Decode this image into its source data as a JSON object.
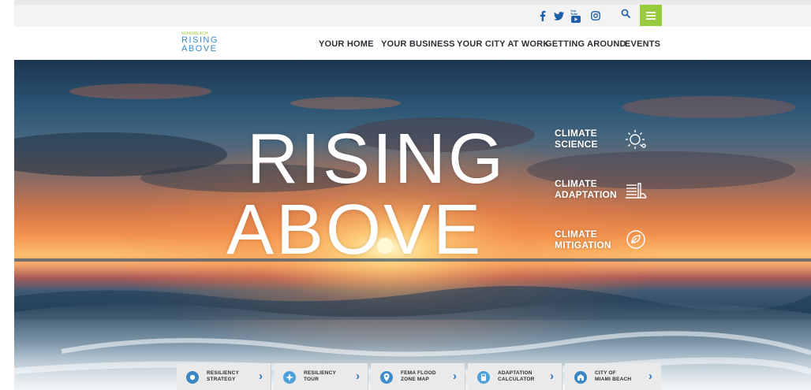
{
  "social": {
    "icons": [
      "facebook-icon",
      "twitter-icon",
      "youtube-icon",
      "instagram-icon"
    ],
    "youtube_text": "You Tube"
  },
  "utility": {
    "search_icon": "search-icon",
    "menu_icon": "hamburger-menu-icon"
  },
  "logo": {
    "small": "MIAMIBEACH",
    "line1": "RISING",
    "line2": "ABOVE"
  },
  "nav": {
    "items": [
      "YOUR HOME",
      "YOUR BUSINESS",
      "YOUR CITY AT WORK",
      "GETTING AROUND",
      "EVENTS"
    ]
  },
  "hero": {
    "title_line1": "RISING",
    "title_line2": "ABOVE"
  },
  "side_links": [
    {
      "line1": "CLIMATE",
      "line2": "SCIENCE",
      "icon": "sun-science-icon"
    },
    {
      "line1": "CLIMATE",
      "line2": "ADAPTATION",
      "icon": "seawall-adaptation-icon"
    },
    {
      "line1": "CLIMATE",
      "line2": "MITIGATION",
      "icon": "leaf-cycle-icon"
    }
  ],
  "cards": [
    {
      "line1": "RESILIENCY",
      "line2": "STRATEGY",
      "icon": "strategy-icon"
    },
    {
      "line1": "RESILIENCY",
      "line2": "TOUR",
      "icon": "tour-icon"
    },
    {
      "line1": "FEMA FLOOD",
      "line2": "ZONE MAP",
      "icon": "map-pin-icon"
    },
    {
      "line1": "ADAPTATION",
      "line2": "CALCULATOR",
      "icon": "calculator-icon"
    },
    {
      "line1": "CITY OF",
      "line2": "MIAMI BEACH",
      "icon": "city-icon"
    }
  ],
  "colors": {
    "accent_green": "#9acb3c",
    "brand_blue": "#3a8dc8",
    "social_blue": "#1f5ea8"
  }
}
